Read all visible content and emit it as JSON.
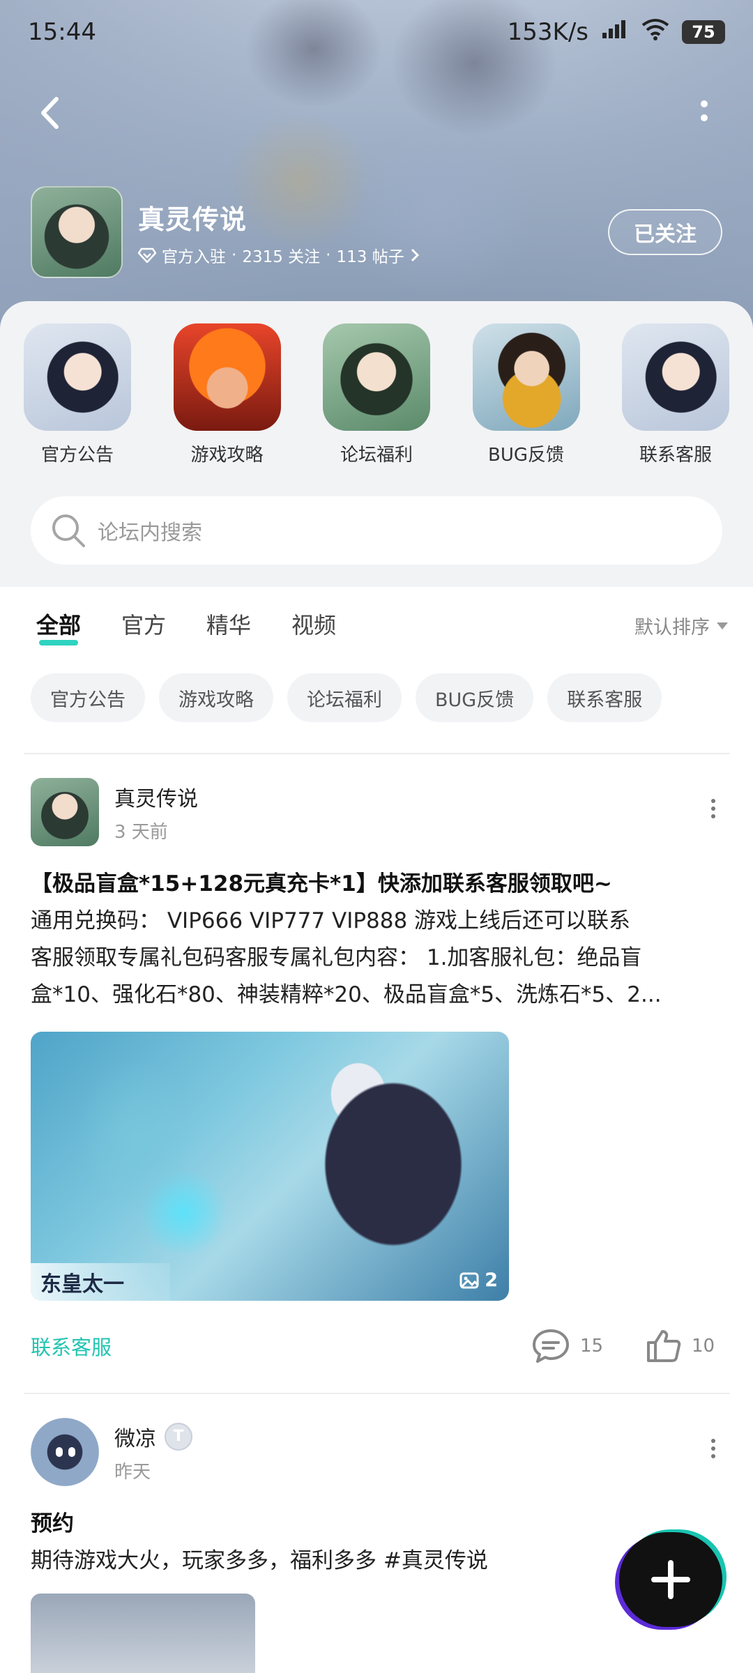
{
  "status_bar": {
    "time": "15:44",
    "net_speed": "153K/s",
    "battery": "75"
  },
  "forum": {
    "title": "真灵传说",
    "official_label": "官方入驻",
    "followers": "2315 关注",
    "posts": "113 帖子",
    "follow_label": "已关注",
    "separator": "·"
  },
  "shortcuts": [
    {
      "label": "官方公告",
      "icon": "immortal-girl-icon"
    },
    {
      "label": "游戏攻略",
      "icon": "flame-demon-icon"
    },
    {
      "label": "论坛福利",
      "icon": "jade-lady-icon"
    },
    {
      "label": "BUG反馈",
      "icon": "swordsman-icon"
    },
    {
      "label": "联系客服",
      "icon": "immortal-girl-icon"
    }
  ],
  "search": {
    "placeholder": "论坛内搜索"
  },
  "tabs": [
    {
      "label": "全部",
      "active": true
    },
    {
      "label": "官方",
      "active": false
    },
    {
      "label": "精华",
      "active": false
    },
    {
      "label": "视频",
      "active": false
    }
  ],
  "sort": {
    "label": "默认排序"
  },
  "chips": [
    "官方公告",
    "游戏攻略",
    "论坛福利",
    "BUG反馈",
    "联系客服"
  ],
  "posts": [
    {
      "author": "真灵传说",
      "time": "3 天前",
      "title": "【极品盲盒*15+128元真充卡*1】快添加联系客服领取吧~",
      "body_lines": [
        "通用兑换码： VIP666 VIP777 VIP888 游戏上线后还可以联系",
        "客服领取专属礼包码客服专属礼包内容： 1.加客服礼包：绝品盲",
        "盒*10、强化石*80、神装精粹*20、极品盲盒*5、洗炼石*5、2..."
      ],
      "image_caption": "东皇太一",
      "image_count": "2",
      "tag": "联系客服",
      "comments": "15",
      "likes": "10"
    },
    {
      "author": "微凉",
      "badge": "T",
      "time": "昨天",
      "title": "预约",
      "body_lines": [
        "期待游戏大火，玩家多多，福利多多 #真灵传说"
      ]
    }
  ],
  "colors": {
    "accent": "#2fd3c0",
    "link": "#22c4b2"
  }
}
